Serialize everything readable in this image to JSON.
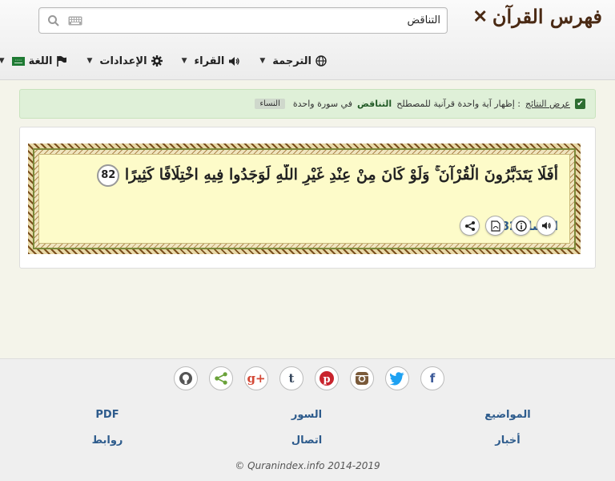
{
  "header": {
    "logo_text": "فهرس القرآن",
    "search": {
      "value": "التناقض",
      "placeholder": ""
    }
  },
  "nav": {
    "translation": "الترجمة",
    "reciters": "القراء",
    "settings": "الإعدادات",
    "language": "اللغة"
  },
  "notice": {
    "link": "عرض النتائج",
    "text_before": ": إظهار آية واحدة قرآنية للمصطلح",
    "term": "التناقض",
    "text_after": "في سورة واحدة",
    "sura_tag": "النساء"
  },
  "verse": {
    "text": "أَفَلَا يَتَدَبَّرُونَ الْقُرْآنَ ۚ وَلَوْ كَانَ مِنْ عِنْدِ غَيْرِ اللَّهِ لَوَجَدُوا فِيهِ اخْتِلَافًا كَثِيرًا",
    "number": "82",
    "reference": "النساء 82"
  },
  "footer": {
    "links": {
      "topics": "المواضيع",
      "suras": "السور",
      "pdf": "PDF",
      "news": "أخبار",
      "contact": "اتصال",
      "links": "روابط"
    },
    "social": [
      "github-icon",
      "share-icon",
      "google-plus-icon",
      "tumblr-icon",
      "pinterest-icon",
      "instagram-icon",
      "twitter-icon",
      "facebook-icon"
    ],
    "copyright": "© Quranindex.info 2014-2019"
  },
  "colors": {
    "link_blue": "#2d5b8c",
    "verse_bg": "#fdfbc9",
    "notice_bg": "#dff0d8",
    "logo_brown": "#4a2a14"
  }
}
